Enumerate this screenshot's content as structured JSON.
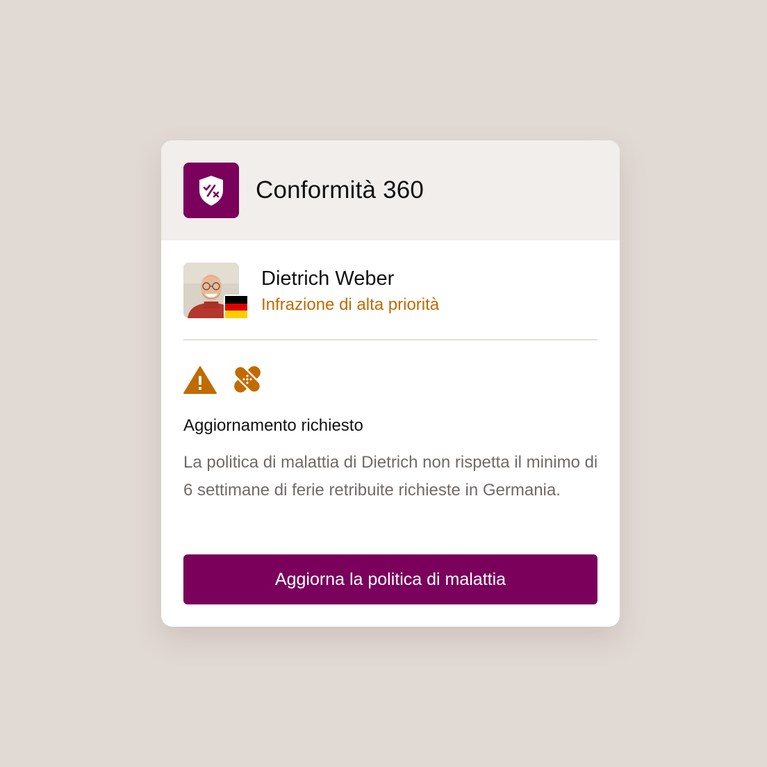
{
  "header": {
    "app_icon": "shield-percent-icon",
    "title": "Conformità 360"
  },
  "user": {
    "name": "Dietrich Weber",
    "status": "Infrazione di alta priorità",
    "country_flag": "germany-flag-icon"
  },
  "alert_icons": [
    "warning-triangle-icon",
    "bandage-icon"
  ],
  "issue": {
    "title": "Aggiornamento richiesto",
    "description": "La politica di malattia di Dietrich non rispetta il minimo di 6 settimane di ferie retribuite richieste in Germania."
  },
  "action": {
    "button_label": "Aggiorna la politica di malattia"
  },
  "colors": {
    "brand": "#7a005c",
    "warning": "#c16a00",
    "background": "#e1d9d4",
    "header_bg": "#f1eeeb"
  }
}
